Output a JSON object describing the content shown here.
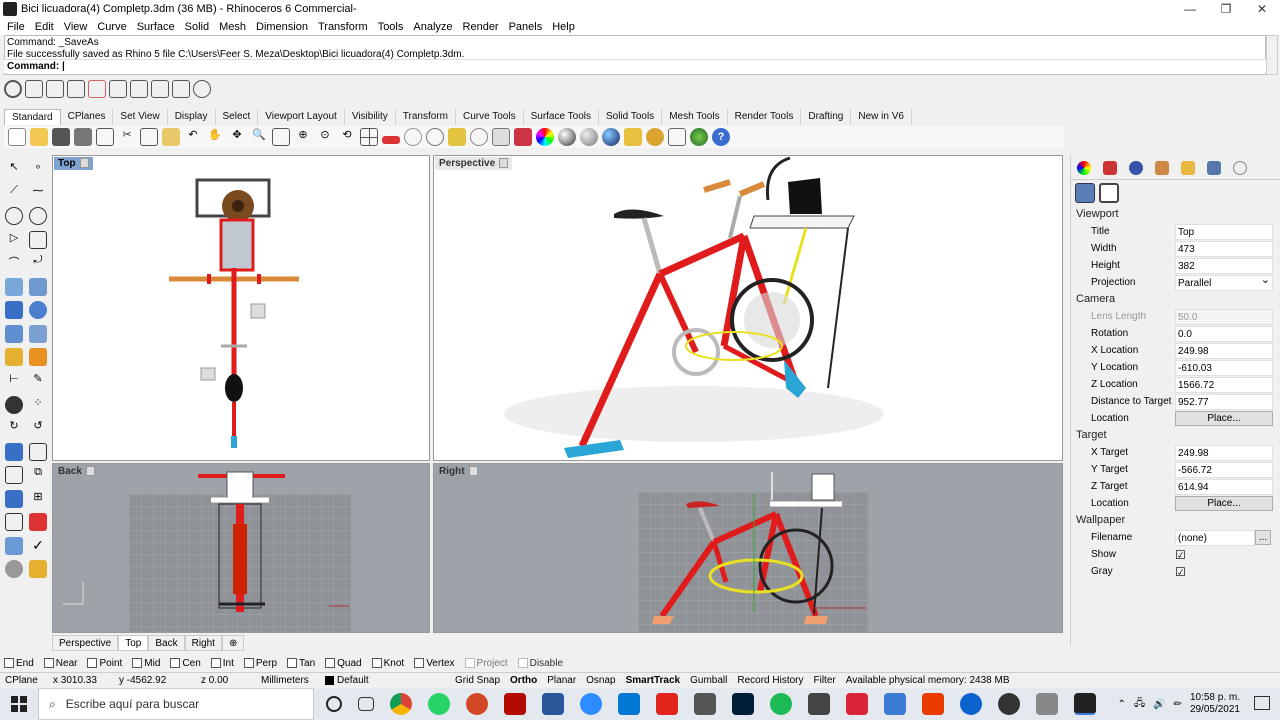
{
  "window": {
    "title": "Bici licuadora(4) Completp.3dm (36 MB) - Rhinoceros 6 Commercial-",
    "minimize": "—",
    "maximize": "❐",
    "close": "✕"
  },
  "menu": [
    "File",
    "Edit",
    "View",
    "Curve",
    "Surface",
    "Solid",
    "Mesh",
    "Dimension",
    "Transform",
    "Tools",
    "Analyze",
    "Render",
    "Panels",
    "Help"
  ],
  "command_history": [
    "Command: _SaveAs",
    "File successfully saved as Rhino 5 file C:\\Users\\Feer S. Meza\\Desktop\\Bici licuadora(4) Completp.3dm."
  ],
  "command_prompt": "Command:",
  "toolbar_tabs": [
    "Standard",
    "CPlanes",
    "Set View",
    "Display",
    "Select",
    "Viewport Layout",
    "Visibility",
    "Transform",
    "Curve Tools",
    "Surface Tools",
    "Solid Tools",
    "Mesh Tools",
    "Render Tools",
    "Drafting",
    "New in V6"
  ],
  "viewports": {
    "top": {
      "label": "Top"
    },
    "perspective": {
      "label": "Perspective"
    },
    "back": {
      "label": "Back"
    },
    "right": {
      "label": "Right"
    }
  },
  "viewport_tabs": [
    "Perspective",
    "Top",
    "Back",
    "Right"
  ],
  "viewport_tab_add": "⊕",
  "panel": {
    "viewport_section": "Viewport",
    "viewport_rows": [
      {
        "label": "Title",
        "value": "Top"
      },
      {
        "label": "Width",
        "value": "473"
      },
      {
        "label": "Height",
        "value": "382"
      },
      {
        "label": "Projection",
        "value": "Parallel"
      }
    ],
    "camera_section": "Camera",
    "camera_rows": [
      {
        "label": "Lens Length",
        "value": "50.0"
      },
      {
        "label": "Rotation",
        "value": "0.0"
      },
      {
        "label": "X Location",
        "value": "249.98"
      },
      {
        "label": "Y Location",
        "value": "-610.03"
      },
      {
        "label": "Z Location",
        "value": "1566.72"
      },
      {
        "label": "Distance to Target",
        "value": "952.77"
      },
      {
        "label": "Location",
        "value": "Place..."
      }
    ],
    "target_section": "Target",
    "target_rows": [
      {
        "label": "X Target",
        "value": "249.98"
      },
      {
        "label": "Y Target",
        "value": "-566.72"
      },
      {
        "label": "Z Target",
        "value": "614.94"
      },
      {
        "label": "Location",
        "value": "Place..."
      }
    ],
    "wallpaper_section": "Wallpaper",
    "wallpaper_rows": [
      {
        "label": "Filename",
        "value": "(none)",
        "extra": "..."
      },
      {
        "label": "Show",
        "value": "☑"
      },
      {
        "label": "Gray",
        "value": "☑"
      }
    ]
  },
  "osnaps": [
    {
      "label": "End",
      "enabled": true
    },
    {
      "label": "Near",
      "enabled": true
    },
    {
      "label": "Point",
      "enabled": true
    },
    {
      "label": "Mid",
      "enabled": true
    },
    {
      "label": "Cen",
      "enabled": true
    },
    {
      "label": "Int",
      "enabled": true
    },
    {
      "label": "Perp",
      "enabled": true
    },
    {
      "label": "Tan",
      "enabled": true
    },
    {
      "label": "Quad",
      "enabled": true
    },
    {
      "label": "Knot",
      "enabled": true
    },
    {
      "label": "Vertex",
      "enabled": true
    },
    {
      "label": "Project",
      "enabled": false
    },
    {
      "label": "Disable",
      "enabled": false
    }
  ],
  "status": {
    "cplane": "CPlane",
    "x": "x 3010.33",
    "y": "y -4562.92",
    "z": "z 0.00",
    "units": "Millimeters",
    "layer": "Default",
    "grid_snap": "Grid Snap",
    "ortho": "Ortho",
    "planar": "Planar",
    "osnap": "Osnap",
    "smarttrack": "SmartTrack",
    "gumball": "Gumball",
    "record_history": "Record History",
    "filter": "Filter",
    "memory": "Available physical memory: 2438 MB"
  },
  "taskbar": {
    "search_placeholder": "Escribe aquí para buscar",
    "time": "10:58 p. m.",
    "date": "29/05/2021"
  },
  "colors": {
    "frame_red": "#e01b1b",
    "accent_blue": "#7ea3d0",
    "cyan_foot": "#2aa6d6",
    "wood": "#d9893a",
    "yellow_chain": "#e8e020"
  }
}
